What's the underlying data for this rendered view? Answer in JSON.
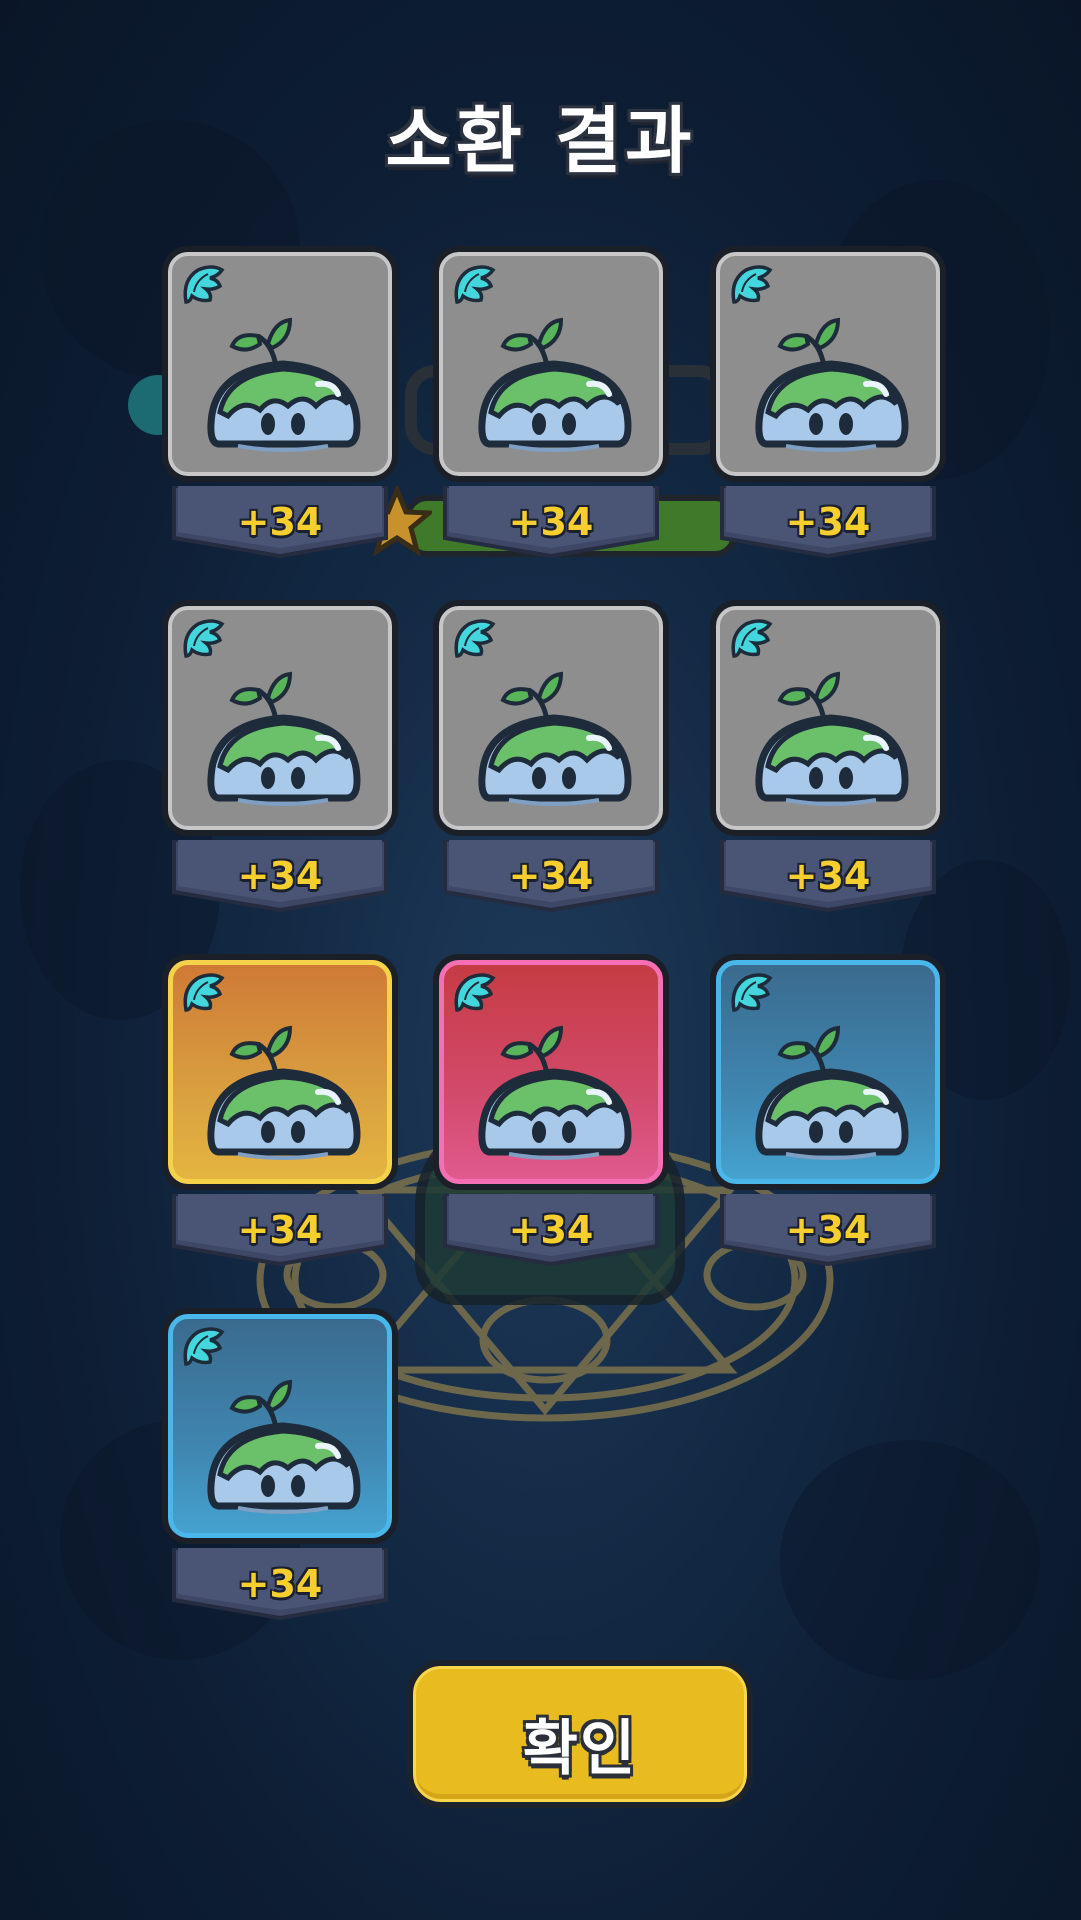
{
  "screen": {
    "title": "소환 결과",
    "confirm_label": "확인"
  },
  "results": [
    {
      "amount": "+34",
      "rarity": "gray",
      "icon": "water-slime-icon",
      "badge_icon": "wing-icon"
    },
    {
      "amount": "+34",
      "rarity": "gray",
      "icon": "water-slime-icon",
      "badge_icon": "wing-icon"
    },
    {
      "amount": "+34",
      "rarity": "gray",
      "icon": "water-slime-icon",
      "badge_icon": "wing-icon"
    },
    {
      "amount": "+34",
      "rarity": "gray",
      "icon": "water-slime-icon",
      "badge_icon": "wing-icon"
    },
    {
      "amount": "+34",
      "rarity": "gray",
      "icon": "water-slime-icon",
      "badge_icon": "wing-icon"
    },
    {
      "amount": "+34",
      "rarity": "gray",
      "icon": "water-slime-icon",
      "badge_icon": "wing-icon"
    },
    {
      "amount": "+34",
      "rarity": "gold",
      "icon": "water-slime-icon",
      "badge_icon": "wing-icon"
    },
    {
      "amount": "+34",
      "rarity": "pink",
      "icon": "water-slime-icon",
      "badge_icon": "wing-icon"
    },
    {
      "amount": "+34",
      "rarity": "blue",
      "icon": "water-slime-icon",
      "badge_icon": "wing-icon"
    },
    {
      "amount": "+34",
      "rarity": "blue",
      "icon": "water-slime-icon",
      "badge_icon": "wing-icon"
    }
  ],
  "colors": {
    "gray": "#8e8e8e",
    "gold": "#d9a040",
    "pink": "#d24a6a",
    "blue": "#3f86b0",
    "amount_text": "#f6cf2e",
    "confirm_button": "#e8bc1f"
  }
}
